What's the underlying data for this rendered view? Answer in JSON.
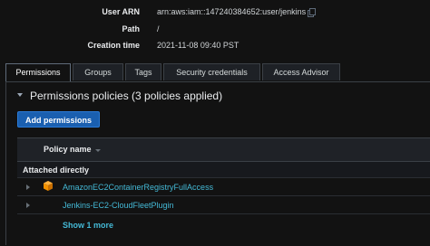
{
  "summary": {
    "user_arn_label": "User ARN",
    "user_arn_value": "arn:aws:iam::147240384652:user/jenkins",
    "path_label": "Path",
    "path_value": "/",
    "creation_label": "Creation time",
    "creation_value": "2021-11-08 09:40 PST"
  },
  "tabs": [
    {
      "label": "Permissions",
      "active": true
    },
    {
      "label": "Groups"
    },
    {
      "label": "Tags"
    },
    {
      "label": "Security credentials"
    },
    {
      "label": "Access Advisor"
    }
  ],
  "permissions": {
    "section_title": "Permissions policies (3 policies applied)",
    "add_button": "Add permissions",
    "column_header": "Policy name",
    "group_label": "Attached directly",
    "policies": [
      {
        "name": "AmazonEC2ContainerRegistryFullAccess",
        "icon": "aws-managed-cube-icon"
      },
      {
        "name": "Jenkins-EC2-CloudFleetPlugin",
        "icon": ""
      }
    ],
    "show_more": "Show 1 more"
  },
  "colors": {
    "background": "#121212",
    "link": "#44b9d6",
    "primary_button": "#1a5fb0",
    "aws_icon": "#f29100"
  }
}
